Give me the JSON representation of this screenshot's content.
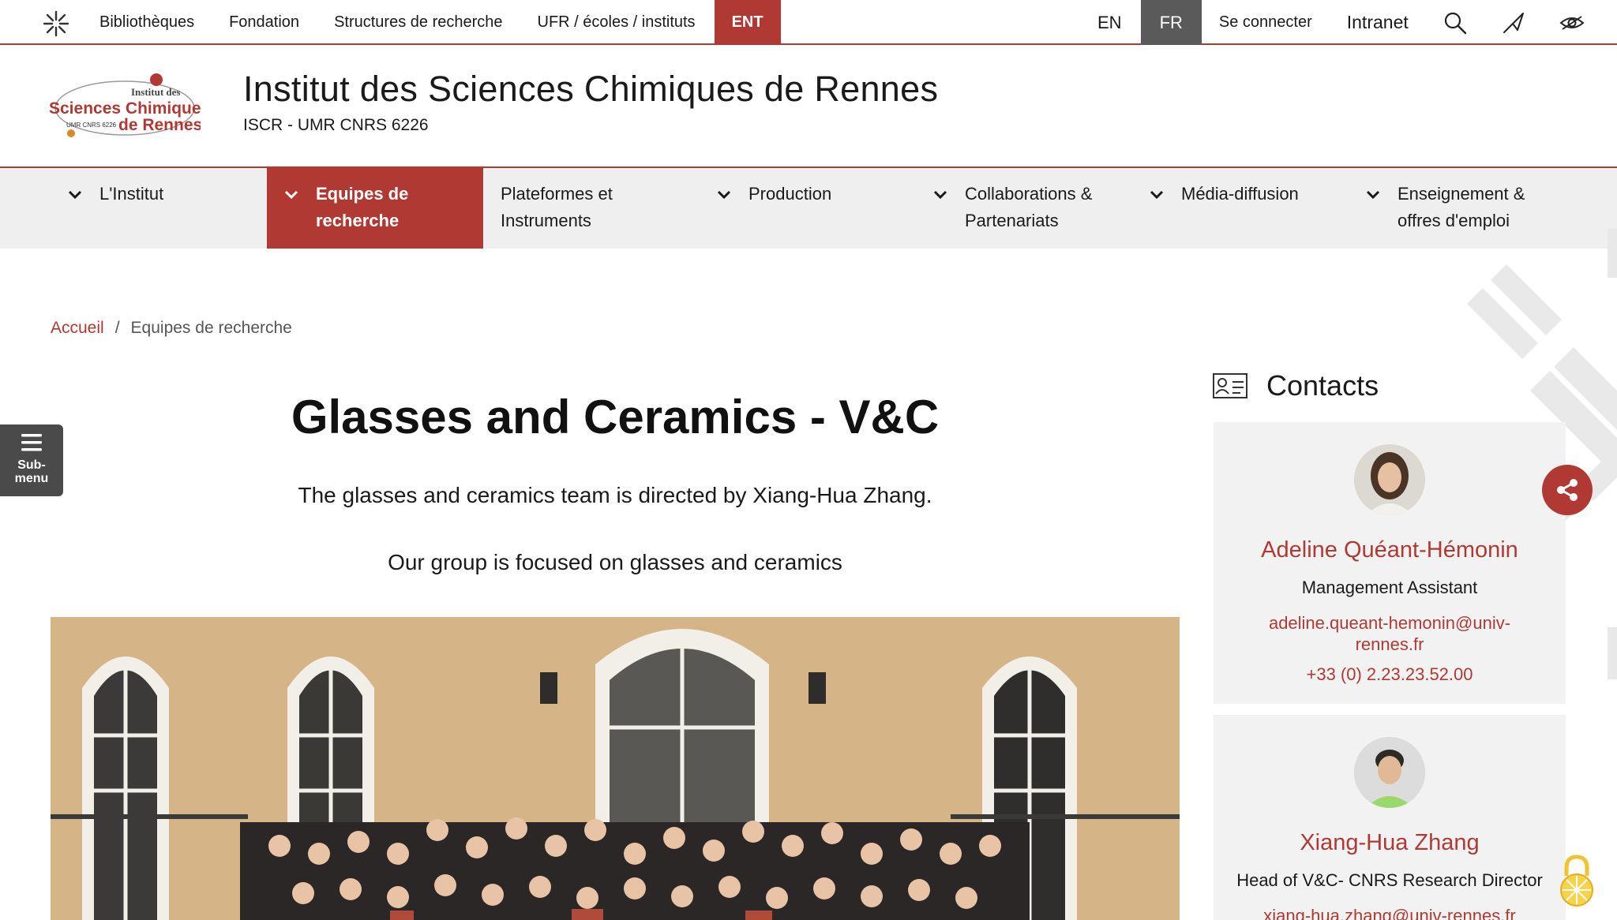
{
  "topbar": {
    "links": [
      "Bibliothèques",
      "Fondation",
      "Structures de recherche",
      "UFR / écoles / instituts"
    ],
    "ent": "ENT",
    "lang_en": "EN",
    "lang_fr": "FR",
    "login": "Se connecter",
    "intranet": "Intranet"
  },
  "header": {
    "title": "Institut des Sciences Chimiques de Rennes",
    "subtitle": "ISCR - UMR CNRS 6226",
    "logo": {
      "line1": "Institut des",
      "line2": "Sciences Chimiques",
      "line3": "de Rennes",
      "badge": "UMR CNRS 6226"
    }
  },
  "nav": [
    {
      "label": "L'Institut"
    },
    {
      "label": "Equipes de recherche",
      "active": true
    },
    {
      "label": "Plateformes et Instruments"
    },
    {
      "label": "Production"
    },
    {
      "label": "Collaborations & Partenariats"
    },
    {
      "label": "Média-diffusion"
    },
    {
      "label": "Enseignement & offres d'emploi"
    }
  ],
  "breadcrumb": {
    "home": "Accueil",
    "separator": "/",
    "current": "Equipes de recherche"
  },
  "submenu": {
    "label": "Sub- menu"
  },
  "main": {
    "title": "Glasses and Ceramics - V&C",
    "intro": "The glasses and ceramics team is directed by Xiang-Hua Zhang.",
    "focus": "Our group is focused on glasses and ceramics"
  },
  "contacts": {
    "heading": "Contacts",
    "people": [
      {
        "name": "Adeline Quéant-Hémonin",
        "role": "Management Assistant",
        "email": "adeline.queant-hemonin@univ-rennes.fr",
        "phone": "+33 (0) 2.23.23.52.00"
      },
      {
        "name": "Xiang-Hua Zhang",
        "role": "Head of V&C- CNRS Research Director",
        "email": "xiang-hua.zhang@univ-rennes.fr"
      }
    ]
  },
  "colors": {
    "accent": "#b03a33",
    "nav_bg": "#efefef",
    "active_lang_bg": "#5a5a5a"
  },
  "icons": [
    "sun-logo-icon",
    "search-icon",
    "paper-plane-icon",
    "eye-icon",
    "chevron-down-icon",
    "contact-card-icon",
    "hamburger-icon",
    "share-icon",
    "lock-icon"
  ]
}
